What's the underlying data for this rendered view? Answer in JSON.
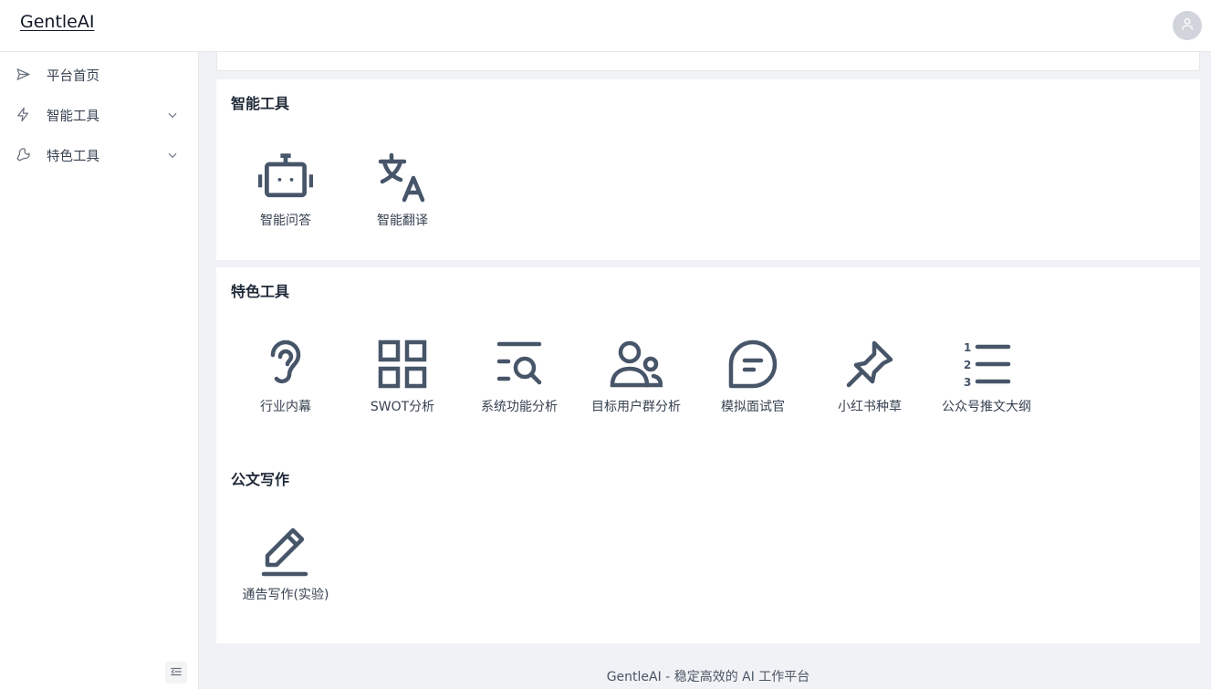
{
  "header": {
    "brand": "GentleAI",
    "avatar_icon": "user-icon"
  },
  "sidebar": {
    "items": [
      {
        "label": "平台首页",
        "icon": "send-icon",
        "expandable": false
      },
      {
        "label": "智能工具",
        "icon": "bolt-icon",
        "expandable": true
      },
      {
        "label": "特色工具",
        "icon": "wrench-icon",
        "expandable": true
      }
    ],
    "collapse_icon": "collapse-sidebar-icon"
  },
  "sections": {
    "smart_tools": {
      "title": "智能工具",
      "tools": [
        {
          "label": "智能问答",
          "icon": "robot-icon"
        },
        {
          "label": "智能翻译",
          "icon": "translate-icon"
        }
      ]
    },
    "feature_tools": {
      "title": "特色工具",
      "tools": [
        {
          "label": "行业内幕",
          "icon": "ear-icon"
        },
        {
          "label": "SWOT分析",
          "icon": "grid-icon"
        },
        {
          "label": "系统功能分析",
          "icon": "list-search-icon"
        },
        {
          "label": "目标用户群分析",
          "icon": "users-icon"
        },
        {
          "label": "模拟面试官",
          "icon": "chat-bubble-icon"
        },
        {
          "label": "小红书种草",
          "icon": "pin-icon"
        },
        {
          "label": "公众号推文大纲",
          "icon": "numbered-list-icon"
        }
      ]
    },
    "doc_writing": {
      "title": "公文写作",
      "tools": [
        {
          "label": "通告写作(实验)",
          "icon": "pencil-icon"
        }
      ]
    }
  },
  "footer": {
    "text": "GentleAI - 稳定高效的 AI 工作平台"
  },
  "colors": {
    "icon": "#475569",
    "background": "#f0f2f5",
    "card": "#ffffff"
  }
}
